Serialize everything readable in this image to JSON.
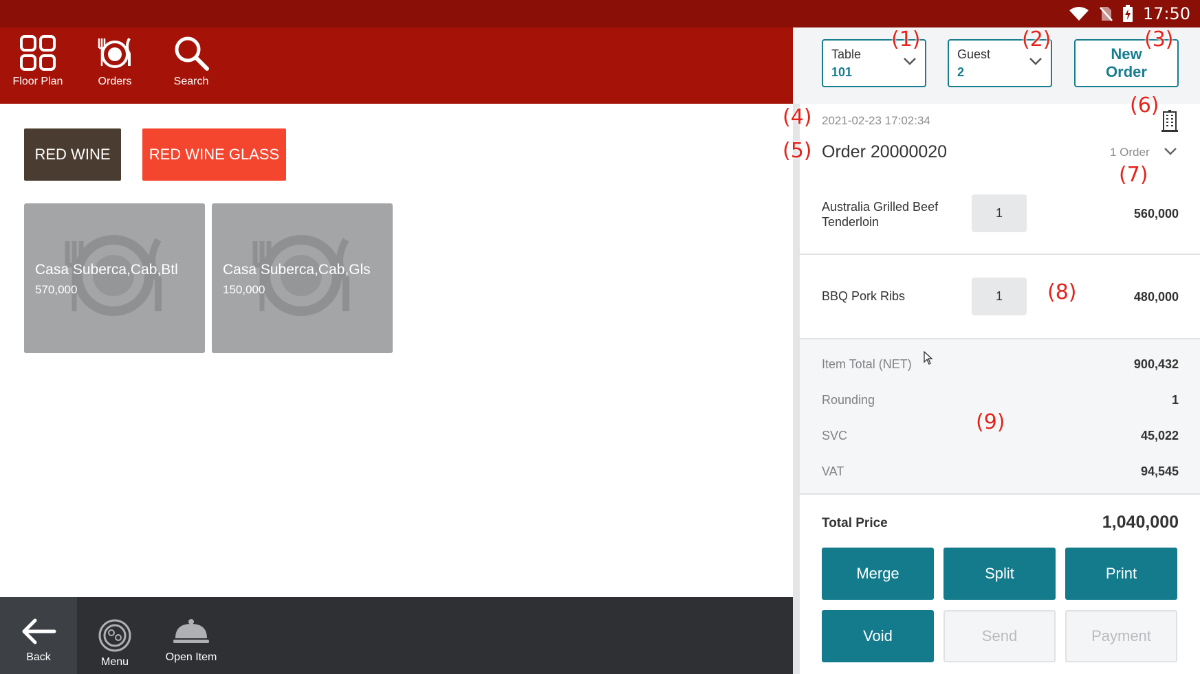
{
  "status_bar": {
    "time": "17:50"
  },
  "toolbar": {
    "floor_plan": "Floor Plan",
    "orders": "Orders",
    "search": "Search"
  },
  "categories": [
    {
      "label": "RED WINE"
    },
    {
      "label": "RED WINE GLASS"
    }
  ],
  "products": [
    {
      "name": "Casa Suberca,Cab,Btl",
      "price": "570,000"
    },
    {
      "name": "Casa Suberca,Cab,Gls",
      "price": "150,000"
    }
  ],
  "bottom_bar": {
    "back": "Back",
    "menu": "Menu",
    "open_item": "Open Item"
  },
  "order_header": {
    "table_label": "Table",
    "table_value": "101",
    "guest_label": "Guest",
    "guest_value": "2",
    "new_order_line1": "New",
    "new_order_line2": "Order"
  },
  "order": {
    "datetime": "2021-02-23 17:02:34",
    "title": "Order 20000020",
    "count": "1 Order",
    "items": [
      {
        "name_line1": "Australia Grilled Beef",
        "name_line2": "Tenderloin",
        "qty": "1",
        "price": "560,000"
      },
      {
        "name_line1": "BBQ Pork Ribs",
        "name_line2": "",
        "qty": "1",
        "price": "480,000"
      }
    ]
  },
  "summary": {
    "item_total_label": "Item Total (NET)",
    "item_total_value": "900,432",
    "rounding_label": "Rounding",
    "rounding_value": "1",
    "svc_label": "SVC",
    "svc_value": "45,022",
    "vat_label": "VAT",
    "vat_value": "94,545",
    "total_label": "Total Price",
    "total_value": "1,040,000"
  },
  "actions": {
    "merge": "Merge",
    "split": "Split",
    "print": "Print",
    "void": "Void",
    "send": "Send",
    "payment": "Payment"
  },
  "annotations": [
    "(1)",
    "(2)",
    "(3)",
    "(4)",
    "(5)",
    "(6)",
    "(7)",
    "(8)",
    "(9)"
  ],
  "colors": {
    "toolbar": "#a51308",
    "statusbar": "#8a0f06",
    "accent_teal": "#137b8c",
    "category_active": "#f4452e",
    "category_dark": "#4a3c30",
    "bottombar": "#2e3033"
  }
}
